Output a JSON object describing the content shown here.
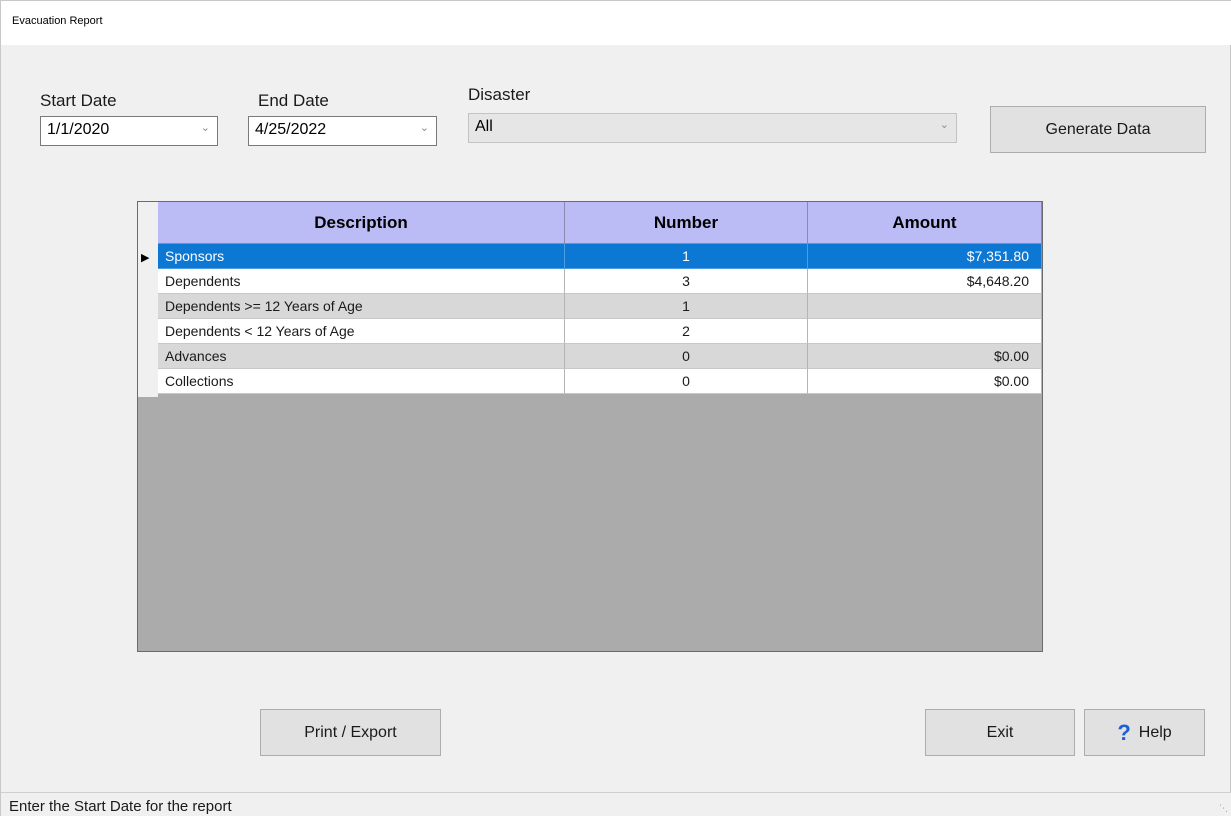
{
  "window": {
    "title": "Evacuation Report"
  },
  "filters": {
    "start_date": {
      "label": "Start Date",
      "value": "1/1/2020"
    },
    "end_date": {
      "label": "End Date",
      "value": "4/25/2022"
    },
    "disaster": {
      "label": "Disaster",
      "value": "All"
    }
  },
  "buttons": {
    "generate": "Generate Data",
    "print_export": "Print / Export",
    "exit": "Exit",
    "help": "Help"
  },
  "grid": {
    "columns": [
      "Description",
      "Number",
      "Amount"
    ],
    "header_color": "#bbbbf5",
    "selection_color": "#0c78d4",
    "rows": [
      {
        "description": "Sponsors",
        "number": "1",
        "amount": "$7,351.80"
      },
      {
        "description": "Dependents",
        "number": "3",
        "amount": "$4,648.20"
      },
      {
        "description": "Dependents >= 12 Years of Age",
        "number": "1",
        "amount": ""
      },
      {
        "description": "Dependents < 12 Years of Age",
        "number": "2",
        "amount": ""
      },
      {
        "description": "Advances",
        "number": "0",
        "amount": "$0.00"
      },
      {
        "description": "Collections",
        "number": "0",
        "amount": "$0.00"
      }
    ]
  },
  "status": {
    "text": "Enter the Start Date for the report"
  },
  "icons": {
    "dropdown": "chevron-down-icon",
    "row_pointer": "row-pointer-icon",
    "help": "question-mark-icon",
    "grip": "resize-grip-icon"
  }
}
